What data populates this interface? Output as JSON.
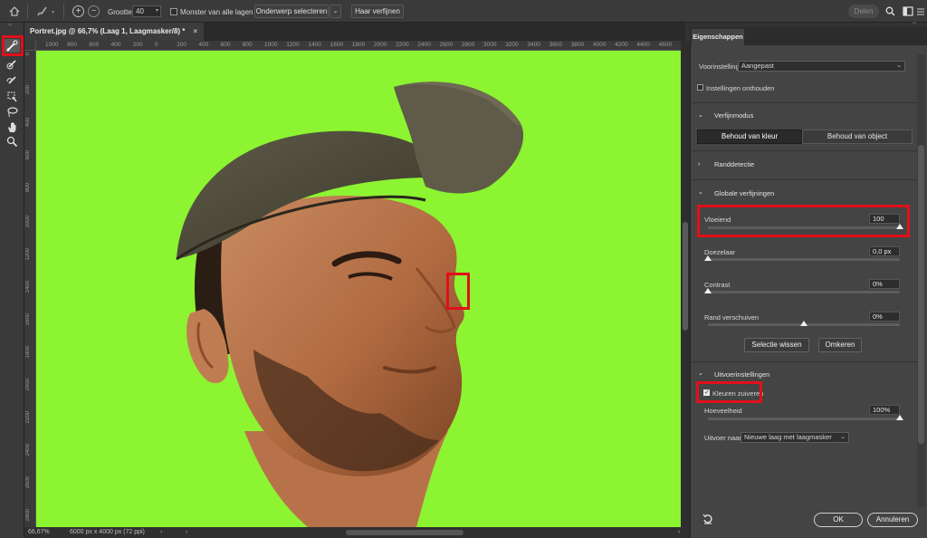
{
  "options_bar": {
    "size_label": "Grootte:",
    "size_value": "40",
    "sample_all_layers": "Monster van alle lagen",
    "select_subject": "Onderwerp selecteren",
    "refine_hair": "Haar verfijnen",
    "share": "Delen"
  },
  "document": {
    "tab_title": "Portret.jpg @ 66,7% (Laag 1, Laagmasker/8) *",
    "h_ruler": [
      "1000",
      "800",
      "600",
      "400",
      "200",
      "0",
      "200",
      "400",
      "600",
      "800",
      "1000",
      "1200",
      "1400",
      "1600",
      "1800",
      "2000",
      "2200",
      "2400",
      "2600",
      "2800",
      "3000",
      "3200",
      "3400",
      "3600",
      "3800",
      "4000",
      "4200",
      "4400",
      "4600",
      "4800"
    ],
    "v_ruler": [
      "0",
      "200",
      "400",
      "600",
      "800",
      "1000",
      "1200",
      "1400",
      "1600",
      "1800",
      "2000",
      "2200",
      "2400",
      "2600",
      "2800"
    ],
    "canvas_color": "#8cf431"
  },
  "status_bar": {
    "zoom": "66,67%",
    "dimensions": "6000 px x 4000 px (72 ppi)"
  },
  "tools": [
    "refine-edge-brush",
    "brush",
    "object-selection",
    "quick-selection",
    "lasso",
    "hand",
    "zoom"
  ],
  "panel": {
    "tab": "Eigenschappen",
    "preset_label": "Voorinstelling",
    "preset_value": "Aangepast",
    "remember_settings": "Instellingen onthouden",
    "view_mode": {
      "title": "Verfijnmodus",
      "option_color": "Behoud van kleur",
      "option_object": "Behoud van object"
    },
    "edge_detection": "Randdetectie",
    "global_refinements": {
      "title": "Globale verfijningen",
      "smooth_label": "Vloeiend",
      "smooth_value": "100",
      "smooth_fraction": 1.0,
      "feather_label": "Doezelaar",
      "feather_value": "0,0 px",
      "feather_fraction": 0.0,
      "contrast_label": "Contrast",
      "contrast_value": "0%",
      "contrast_fraction": 0.0,
      "shift_edge_label": "Rand verschuiven",
      "shift_edge_value": "0%",
      "shift_edge_fraction": 0.5,
      "clear_selection": "Selectie wissen",
      "invert": "Omkeren"
    },
    "output": {
      "title": "Uitvoerinstellingen",
      "decontaminate": "Kleuren zuiveren",
      "amount_label": "Hoeveelheid",
      "amount_value": "100%",
      "amount_fraction": 1.0,
      "output_to_label": "Uitvoer naar",
      "output_to_value": "Nieuwe laag met laagmasker"
    },
    "ok": "OK",
    "cancel": "Annuleren"
  }
}
